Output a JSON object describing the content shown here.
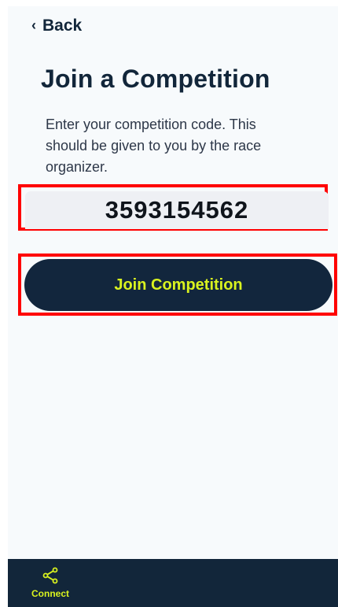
{
  "header": {
    "back_label": "Back"
  },
  "main": {
    "title": "Join a Competition",
    "description": "Enter your competition code. This should be given to you by the race organizer.",
    "code_value": "3593154562",
    "button_label": "Join Competition"
  },
  "bottom_nav": {
    "items": [
      {
        "label": "Connect",
        "icon": "share-icon"
      }
    ]
  },
  "colors": {
    "navy": "#12263a",
    "accent": "#d9f21f",
    "highlight": "#ff0000",
    "background": "#f7fafc"
  }
}
